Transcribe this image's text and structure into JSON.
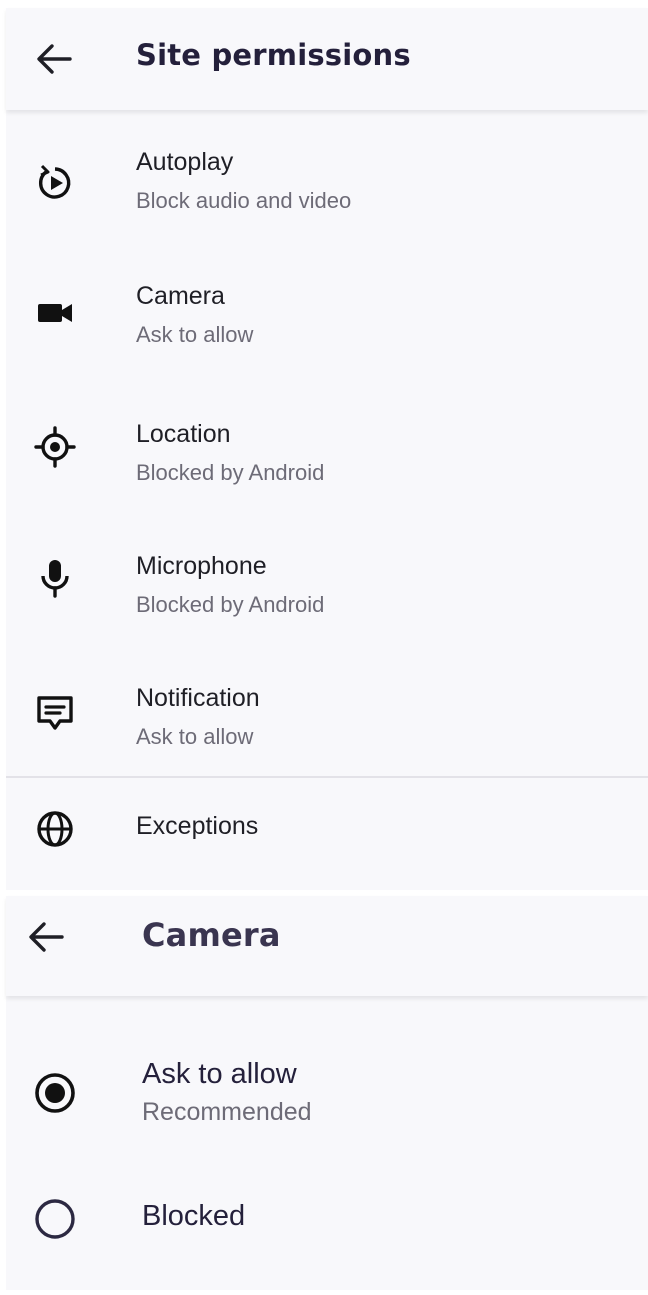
{
  "site_permissions": {
    "title": "Site permissions",
    "items": [
      {
        "title": "Autoplay",
        "subtitle": "Block audio and video",
        "icon": "autoplay-icon"
      },
      {
        "title": "Camera",
        "subtitle": "Ask to allow",
        "icon": "camera-icon"
      },
      {
        "title": "Location",
        "subtitle": "Blocked by Android",
        "icon": "location-icon"
      },
      {
        "title": "Microphone",
        "subtitle": "Blocked by Android",
        "icon": "microphone-icon"
      },
      {
        "title": "Notification",
        "subtitle": "Ask to allow",
        "icon": "notification-icon"
      }
    ],
    "exceptions": {
      "title": "Exceptions",
      "icon": "globe-icon"
    }
  },
  "camera_screen": {
    "title": "Camera",
    "options": [
      {
        "label": "Ask to allow",
        "subtitle": "Recommended",
        "selected": true
      },
      {
        "label": "Blocked",
        "selected": false
      }
    ]
  },
  "colors": {
    "highlight": "#fbff00",
    "text_primary": "#1f1f26",
    "text_secondary": "#6d6b77",
    "background": "#f8f8fb"
  }
}
